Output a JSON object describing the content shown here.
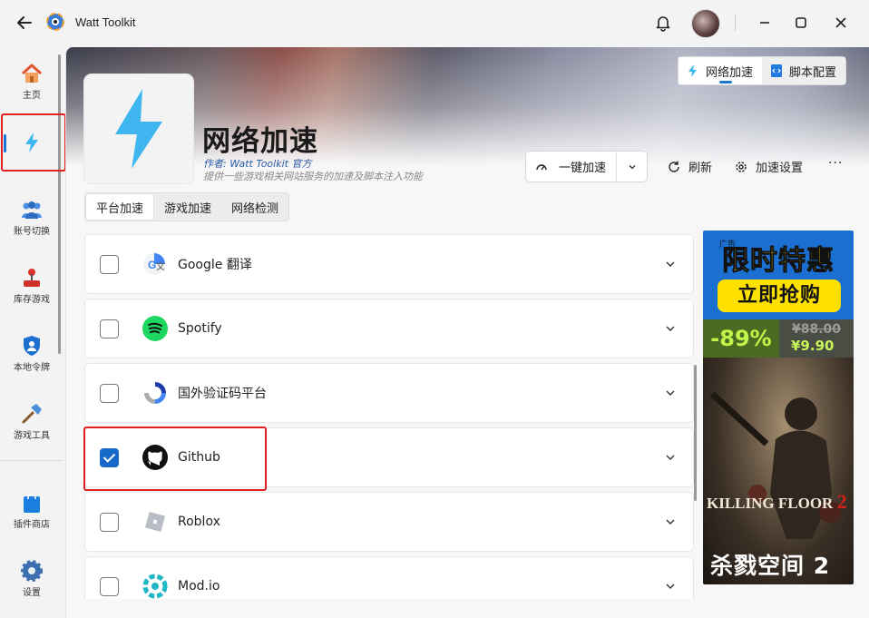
{
  "titlebar": {
    "app_title": "Watt Toolkit"
  },
  "sidebar": {
    "items": [
      {
        "label": "主页"
      },
      {
        "label": ""
      },
      {
        "label": "账号切换"
      },
      {
        "label": "库存游戏"
      },
      {
        "label": "本地令牌"
      },
      {
        "label": "游戏工具"
      },
      {
        "label": "插件商店"
      },
      {
        "label": "设置"
      }
    ]
  },
  "header": {
    "seg_tabs": [
      {
        "label": "网络加速"
      },
      {
        "label": "脚本配置"
      }
    ],
    "title": "网络加速",
    "author": "作者:  Watt Toolkit  官方",
    "description": "提供一些游戏相关网站服务的加速及脚本注入功能",
    "one_click": "一键加速",
    "refresh": "刷新",
    "accel_settings": "加速设置",
    "more": "···"
  },
  "tabs": [
    {
      "label": "平台加速"
    },
    {
      "label": "游戏加速"
    },
    {
      "label": "网络检测"
    }
  ],
  "services": [
    {
      "name": "Google 翻译",
      "checked": false
    },
    {
      "name": "Spotify",
      "checked": false
    },
    {
      "name": "国外验证码平台",
      "checked": false
    },
    {
      "name": "Github",
      "checked": true
    },
    {
      "name": "Roblox",
      "checked": false
    },
    {
      "name": "Mod.io",
      "checked": false
    }
  ],
  "ad": {
    "corner": "广告",
    "headline": "限时特惠",
    "cta": "立即抢购",
    "discount": "-89%",
    "old_price": "¥88.00",
    "new_price": "¥9.90",
    "game_title_a": "KILLING FLOOR",
    "game_title_b": "2",
    "game_title_cn": "杀戮空间 2"
  },
  "colors": {
    "accent": "#1a74d6",
    "highlight": "#e02020",
    "checked": "#1669c8",
    "bolt": "#3fb6f0"
  }
}
